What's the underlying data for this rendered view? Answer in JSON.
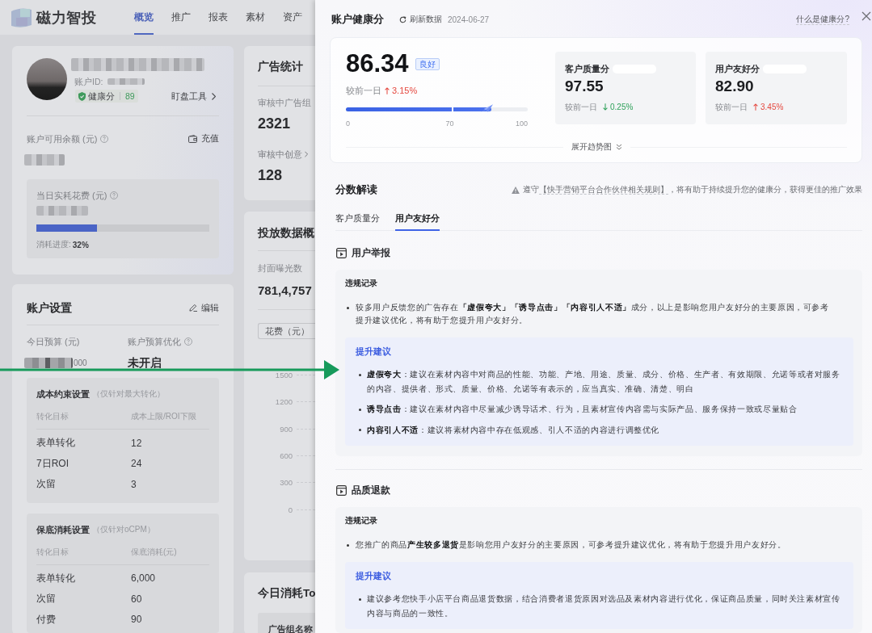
{
  "app": {
    "logo_text": "磁力智投",
    "nav": [
      {
        "label": "概览",
        "selected": true
      },
      {
        "label": "推广",
        "selected": false
      },
      {
        "label": "报表",
        "selected": false
      },
      {
        "label": "素材",
        "selected": false
      },
      {
        "label": "资产",
        "selected": false
      }
    ]
  },
  "profile": {
    "id_label": "账户ID:",
    "health_label": "健康分",
    "health_score": "89",
    "tool_link": "盯盘工具",
    "balance_label": "账户可用余额 (元)",
    "recharge": "充值",
    "spend_label": "当日实耗花费 (元)",
    "spend_progress": {
      "level": 0.35,
      "label": "消耗进度:",
      "value": "32%"
    }
  },
  "settings": {
    "title": "账户设置",
    "edit": "编辑",
    "fields": [
      {
        "label": "今日预算 (元)",
        "help": false,
        "kind": "redacted",
        "value": "000"
      },
      {
        "label": "账户预算优化",
        "help": true,
        "kind": "text",
        "value": "未开启"
      }
    ],
    "tables": [
      {
        "title": "成本约束设置",
        "note": "（仅针对最大转化）",
        "columns": [
          "转化目标",
          "成本上限/ROI下限"
        ],
        "rows": [
          [
            "表单转化",
            "12"
          ],
          [
            "7日ROI",
            "24"
          ],
          [
            "次留",
            "3"
          ]
        ]
      },
      {
        "title": "保底消耗设置",
        "note": "（仅针对oCPM）",
        "columns": [
          "转化目标",
          "保底消耗(元)"
        ],
        "rows": [
          [
            "表单转化",
            "6,000"
          ],
          [
            "次留",
            "60"
          ],
          [
            "付费",
            "90"
          ]
        ]
      }
    ]
  },
  "ad_stats": {
    "title": "广告统计",
    "items": [
      {
        "label": "审核中广告组",
        "link": false,
        "value": "2321"
      },
      {
        "label": "审核中创意",
        "link": true,
        "value": "128"
      }
    ]
  },
  "delivery": {
    "title": "投放数据概",
    "metric_label": "封面曝光数",
    "metric_value": "781,4,757",
    "select": "花费（元）",
    "y_axis": [
      "1500",
      "1200",
      "900",
      "600",
      "300",
      "0"
    ]
  },
  "top_spend": {
    "title": "今日消耗To",
    "column_1": "广告组名称"
  },
  "drawer": {
    "title": "账户健康分",
    "refresh": "刷新数据",
    "date": "2024-06-27",
    "help_link": "什么是健康分?",
    "score": {
      "value": "86.34",
      "grade": "良好",
      "compare_label": "较前一日",
      "change": "3.15%",
      "rising": true,
      "level": 0.8,
      "scale": [
        "0",
        "70",
        "100"
      ]
    },
    "sub_scores": [
      {
        "label": "客户质量分",
        "value": "97.55",
        "compare_label": "较前一日",
        "change": "0.25%",
        "rising": false
      },
      {
        "label": "用户友好分",
        "value": "82.90",
        "compare_label": "较前一日",
        "change": "3.45%",
        "rising": true
      }
    ],
    "expand": "展开趋势图",
    "analysis": {
      "title": "分数解读",
      "notice": {
        "prefix": "遵守",
        "link": "【快手营销平台合作伙伴相关规则】",
        "suffix": "，将有助于持续提升您的健康分，获得更佳的推广效果"
      },
      "tabs": [
        {
          "label": "客户质量分",
          "selected": false
        },
        {
          "label": "用户友好分",
          "selected": true
        }
      ],
      "sections": [
        {
          "title": "用户举报",
          "record_title": "违规记录",
          "records": [
            "较多用户反馈您的广告存在**「虚假夸大」「诱导点击」「内容引人不适」**成分，以上是影响您用户友好分的主要原因，可参考提升建议优化，将有助于您提升用户友好分。"
          ],
          "advice_title": "提升建议",
          "advice": [
            "**虚假夸大**：建议在素材内容中对商品的性能、功能、产地、用途、质量、成分、价格、生产者、有效期限、允诺等或者对服务的内容、提供者、形式、质量、价格、允诺等有表示的，应当真实、准确、清楚、明白",
            "**诱导点击**：建议在素材内容中尽量减少诱导话术、行为，且素材宣传内容需与实际产品、服务保持一致或尽量贴合",
            "**内容引人不适**：建议将素材内容中存在低观感、引人不适的内容进行调整优化"
          ]
        },
        {
          "title": "品质退款",
          "record_title": "违规记录",
          "records": [
            "您推广的商品**产生较多退货**是影响您用户友好分的主要原因，可参考提升建议优化，将有助于您提升用户友好分。"
          ],
          "advice_title": "提升建议",
          "advice": [
            "建议参考您快手小店平台商品退货数据，结合消费者退货原因对选品及素材内容进行优化，保证商品质量，同时关注素材宣传内容与商品的一致性。"
          ]
        }
      ]
    }
  }
}
